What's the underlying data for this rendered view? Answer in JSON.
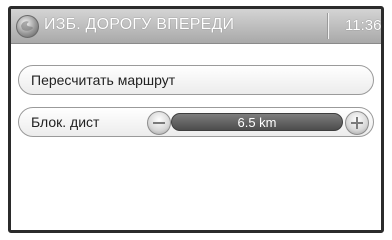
{
  "header": {
    "title": "ИЗБ. ДОРОГУ ВПЕРЕДИ",
    "time": "11:36",
    "icon": "globe-icon"
  },
  "menu": {
    "recalculate_label": "Пересчитать маршрут",
    "block_distance": {
      "label": "Блок. дист",
      "value": "6.5 km",
      "decrease_icon": "minus-icon",
      "increase_icon": "plus-icon"
    }
  },
  "colors": {
    "titlebar": "#b8b8b8",
    "value_bar": "#5e5e5e",
    "frame": "#2b2b2b"
  }
}
